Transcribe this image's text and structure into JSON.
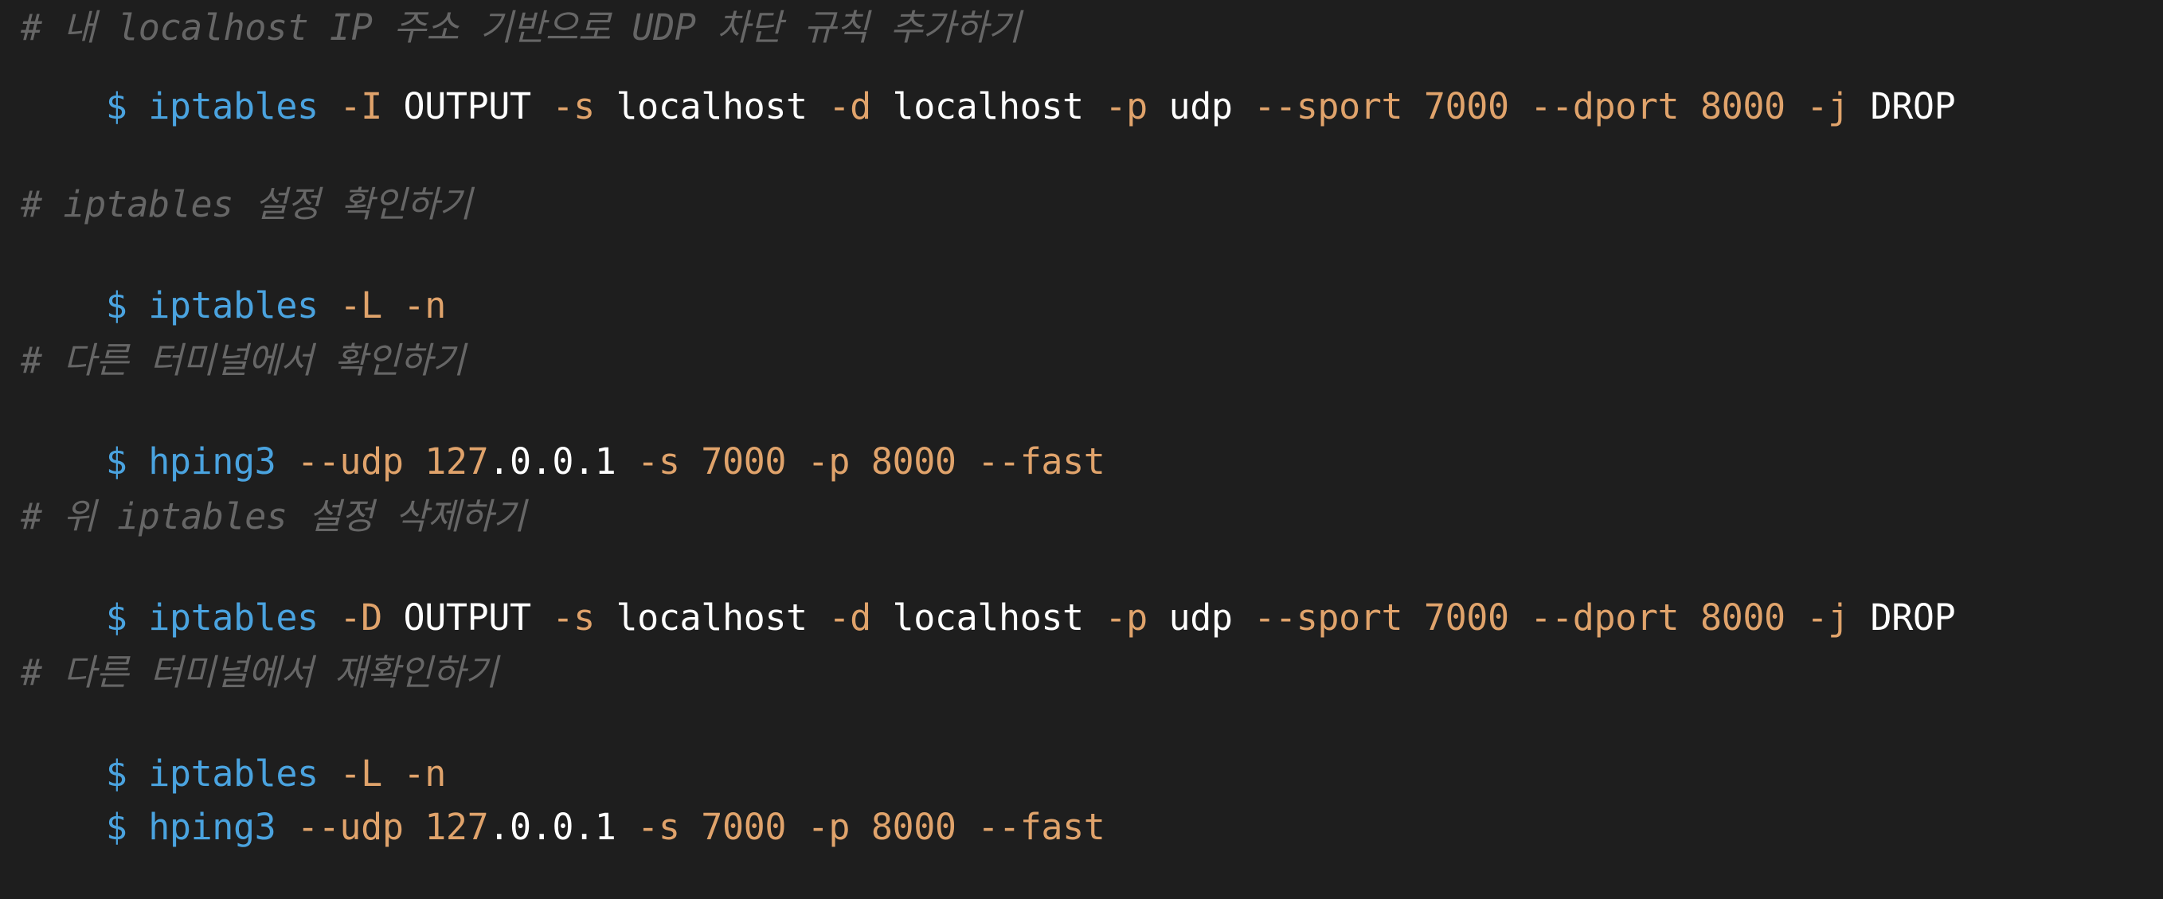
{
  "colors": {
    "background": "#1e1e1e",
    "comment": "#666666",
    "command": "#4aa3df",
    "flag": "#e0a36b",
    "argument": "#ffffff"
  },
  "lines": [
    {
      "kind": "comment",
      "text": "# 내 localhost IP 주소 기반으로 UDP 차단 규칙 추가하기"
    },
    {
      "kind": "command",
      "prompt": "$",
      "tokens": [
        {
          "t": "cmd",
          "v": "iptables"
        },
        {
          "t": "flag",
          "v": "-I"
        },
        {
          "t": "plain",
          "v": "OUTPUT"
        },
        {
          "t": "flag",
          "v": "-s"
        },
        {
          "t": "plain",
          "v": "localhost"
        },
        {
          "t": "flag",
          "v": "-d"
        },
        {
          "t": "plain",
          "v": "localhost"
        },
        {
          "t": "flag",
          "v": "-p"
        },
        {
          "t": "plain",
          "v": "udp"
        },
        {
          "t": "flag",
          "v": "--sport"
        },
        {
          "t": "num",
          "v": "7000"
        },
        {
          "t": "flag",
          "v": "--dport"
        },
        {
          "t": "num",
          "v": "8000"
        },
        {
          "t": "flag",
          "v": "-j"
        },
        {
          "t": "plain",
          "v": "DROP"
        }
      ]
    },
    {
      "kind": "comment",
      "text": "# iptables 설정 확인하기"
    },
    {
      "kind": "command",
      "prompt": "$",
      "tokens": [
        {
          "t": "cmd",
          "v": "iptables"
        },
        {
          "t": "flag",
          "v": "-L"
        },
        {
          "t": "flag",
          "v": "-n"
        }
      ]
    },
    {
      "kind": "comment",
      "text": "# 다른 터미널에서 확인하기"
    },
    {
      "kind": "command",
      "prompt": "$",
      "tokens": [
        {
          "t": "cmd",
          "v": "hping3"
        },
        {
          "t": "flag",
          "v": "--udp"
        },
        {
          "t": "ip",
          "a": "127",
          "b": ".0.0.1"
        },
        {
          "t": "flag",
          "v": "-s"
        },
        {
          "t": "num",
          "v": "7000"
        },
        {
          "t": "flag",
          "v": "-p"
        },
        {
          "t": "num",
          "v": "8000"
        },
        {
          "t": "flag",
          "v": "--fast"
        }
      ]
    },
    {
      "kind": "comment",
      "text": "# 위 iptables 설정 삭제하기"
    },
    {
      "kind": "command",
      "prompt": "$",
      "tokens": [
        {
          "t": "cmd",
          "v": "iptables"
        },
        {
          "t": "flag",
          "v": "-D"
        },
        {
          "t": "plain",
          "v": "OUTPUT"
        },
        {
          "t": "flag",
          "v": "-s"
        },
        {
          "t": "plain",
          "v": "localhost"
        },
        {
          "t": "flag",
          "v": "-d"
        },
        {
          "t": "plain",
          "v": "localhost"
        },
        {
          "t": "flag",
          "v": "-p"
        },
        {
          "t": "plain",
          "v": "udp"
        },
        {
          "t": "flag",
          "v": "--sport"
        },
        {
          "t": "num",
          "v": "7000"
        },
        {
          "t": "flag",
          "v": "--dport"
        },
        {
          "t": "num",
          "v": "8000"
        },
        {
          "t": "flag",
          "v": "-j"
        },
        {
          "t": "plain",
          "v": "DROP"
        }
      ]
    },
    {
      "kind": "comment",
      "text": "# 다른 터미널에서 재확인하기"
    },
    {
      "kind": "command",
      "prompt": "$",
      "tokens": [
        {
          "t": "cmd",
          "v": "iptables"
        },
        {
          "t": "flag",
          "v": "-L"
        },
        {
          "t": "flag",
          "v": "-n"
        }
      ]
    },
    {
      "kind": "command",
      "prompt": "$",
      "tokens": [
        {
          "t": "cmd",
          "v": "hping3"
        },
        {
          "t": "flag",
          "v": "--udp"
        },
        {
          "t": "ip",
          "a": "127",
          "b": ".0.0.1"
        },
        {
          "t": "flag",
          "v": "-s"
        },
        {
          "t": "num",
          "v": "7000"
        },
        {
          "t": "flag",
          "v": "-p"
        },
        {
          "t": "num",
          "v": "8000"
        },
        {
          "t": "flag",
          "v": "--fast"
        }
      ]
    }
  ]
}
